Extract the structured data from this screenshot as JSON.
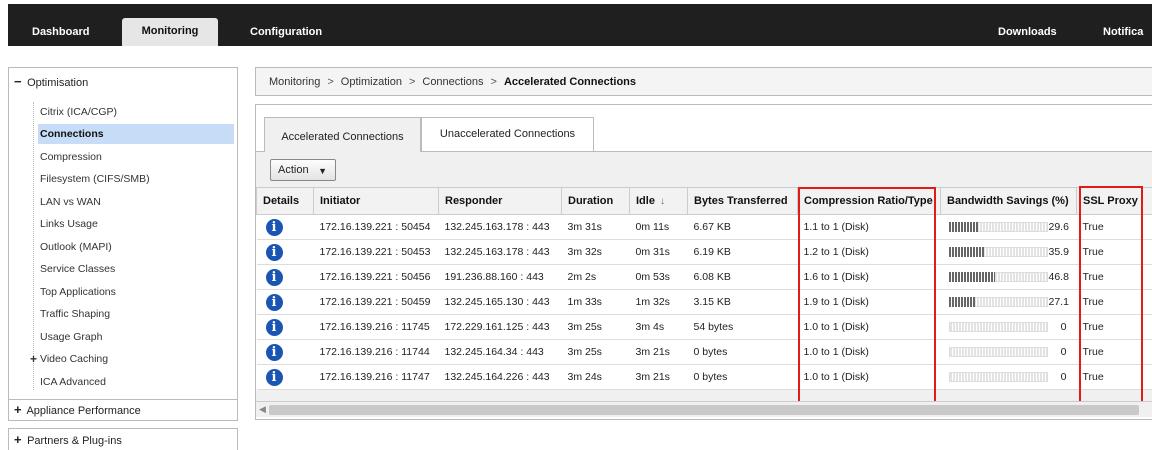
{
  "nav": {
    "dashboard": "Dashboard",
    "monitoring": "Monitoring",
    "configuration": "Configuration",
    "downloads": "Downloads",
    "notifications": "Notifica"
  },
  "sidebar": {
    "header": "Optimisation",
    "header_sign": "−",
    "items": [
      {
        "label": "Citrix (ICA/CGP)"
      },
      {
        "label": "Connections"
      },
      {
        "label": "Compression"
      },
      {
        "label": "Filesystem (CIFS/SMB)"
      },
      {
        "label": "LAN vs WAN"
      },
      {
        "label": "Links Usage"
      },
      {
        "label": "Outlook (MAPI)"
      },
      {
        "label": "Service Classes"
      },
      {
        "label": "Top Applications"
      },
      {
        "label": "Traffic Shaping"
      },
      {
        "label": "Usage Graph"
      },
      {
        "label": "Video Caching",
        "expandable": "+"
      },
      {
        "label": "ICA Advanced"
      }
    ],
    "appliance_performance": "Appliance Performance",
    "partners_plugins": "Partners & Plug-ins",
    "plus_sign": "+"
  },
  "breadcrumb": {
    "items": [
      "Monitoring",
      "Optimization",
      "Connections"
    ],
    "current": "Accelerated Connections",
    "separator": ">"
  },
  "tabs": {
    "accelerated": "Accelerated Connections",
    "unaccelerated": "Unaccelerated Connections"
  },
  "action_button": "Action",
  "table": {
    "headers": {
      "details": "Details",
      "initiator": "Initiator",
      "responder": "Responder",
      "duration": "Duration",
      "idle": "Idle",
      "bytes": "Bytes Transferred",
      "compression": "Compression Ratio/Type",
      "bandwidth": "Bandwidth Savings (%)",
      "ssl": "SSL Proxy"
    },
    "rows": [
      {
        "initiator": "172.16.139.221 : 50454",
        "responder": "132.245.163.178 : 443",
        "duration": "3m 31s",
        "idle": "0m 11s",
        "bytes": "6.67 KB",
        "compression": "1.1 to 1 (Disk)",
        "bandwidth": "29.6",
        "bandwidth_pct": 29.6,
        "ssl": "True"
      },
      {
        "initiator": "172.16.139.221 : 50453",
        "responder": "132.245.163.178 : 443",
        "duration": "3m 32s",
        "idle": "0m 31s",
        "bytes": "6.19 KB",
        "compression": "1.2 to 1 (Disk)",
        "bandwidth": "35.9",
        "bandwidth_pct": 35.9,
        "ssl": "True"
      },
      {
        "initiator": "172.16.139.221 : 50456",
        "responder": "191.236.88.160 : 443",
        "duration": "2m 2s",
        "idle": "0m 53s",
        "bytes": "6.08 KB",
        "compression": "1.6 to 1 (Disk)",
        "bandwidth": "46.8",
        "bandwidth_pct": 46.8,
        "ssl": "True"
      },
      {
        "initiator": "172.16.139.221 : 50459",
        "responder": "132.245.165.130 : 443",
        "duration": "1m 33s",
        "idle": "1m 32s",
        "bytes": "3.15 KB",
        "compression": "1.9 to 1 (Disk)",
        "bandwidth": "27.1",
        "bandwidth_pct": 27.1,
        "ssl": "True"
      },
      {
        "initiator": "172.16.139.216 : 11745",
        "responder": "172.229.161.125 : 443",
        "duration": "3m 25s",
        "idle": "3m 4s",
        "bytes": "54 bytes",
        "compression": "1.0 to 1 (Disk)",
        "bandwidth": "0",
        "bandwidth_pct": 0,
        "ssl": "True"
      },
      {
        "initiator": "172.16.139.216 : 11744",
        "responder": "132.245.164.34 : 443",
        "duration": "3m 25s",
        "idle": "3m 21s",
        "bytes": "0 bytes",
        "compression": "1.0 to 1 (Disk)",
        "bandwidth": "0",
        "bandwidth_pct": 0,
        "ssl": "True"
      },
      {
        "initiator": "172.16.139.216 : 11747",
        "responder": "132.245.164.226 : 443",
        "duration": "3m 24s",
        "idle": "3m 21s",
        "bytes": "0 bytes",
        "compression": "1.0 to 1 (Disk)",
        "bandwidth": "0",
        "bandwidth_pct": 0,
        "ssl": "True"
      }
    ],
    "info_icon_glyph": "i",
    "sort_glyph": "↓"
  },
  "colors": {
    "nav_bar": "#1f1f1f",
    "selected_item": "#c7dcf7",
    "info_icon": "#1a55b4",
    "highlight_box": "#e01b1b"
  },
  "icons": {
    "info": "info-circle-icon",
    "dropdown": "caret-down-icon",
    "sort": "sort-down-arrow-icon",
    "scroll_left": "scroll-left-arrow-icon"
  }
}
